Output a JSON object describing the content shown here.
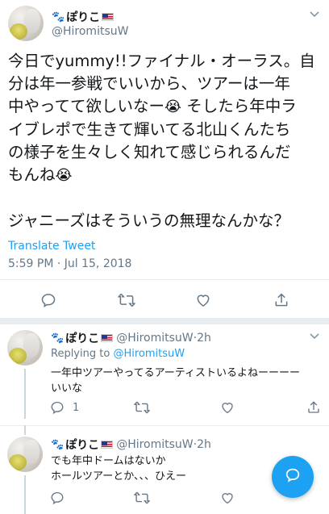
{
  "main_tweet": {
    "display_name": "ぽりこ",
    "handle": "@HiromitsuW",
    "text_lines": [
      "今日でyummy!!ファイナル・オーラス。自",
      "分は年一参戦でいいから、ツアーは一年",
      "中やってて欲しいなー",
      " そしたら年中ラ",
      "イブレポで生きて輝いてる北山くんたち",
      "の様子を生々しく知れて感じられるんだ",
      "もんね",
      "ジャニーズはそういうの無理なんかな？"
    ],
    "emoji": "😭",
    "translate_label": "Translate Tweet",
    "timestamp": "5:59 PM · Jul 15, 2018"
  },
  "replies": [
    {
      "display_name": "ぽりこ",
      "handle": "@HiromitsuW",
      "time": "2h",
      "replying_prefix": "Replying to",
      "replying_to": "@HiromitsuW",
      "text_lines": [
        "一年中ツアーやってるアーティストいるよねーーーー",
        "いいな"
      ],
      "reply_count": "1"
    },
    {
      "display_name": "ぽりこ",
      "handle": "@HiromitsuW",
      "time": "2h",
      "text_lines": [
        "でも年中ドームはないか",
        "ホールツアーとか、、、ひえー"
      ]
    }
  ],
  "separator": " · ",
  "icons": {
    "paw": "paw-icon",
    "flag": "us-flag-icon",
    "chevron": "chevron-down-icon",
    "reply": "reply-icon",
    "retweet": "retweet-icon",
    "like": "heart-icon",
    "share": "share-icon",
    "compose": "compose-icon"
  },
  "colors": {
    "accent": "#1da1f2",
    "secondary_text": "#657786",
    "divider": "#e6ecf0"
  }
}
